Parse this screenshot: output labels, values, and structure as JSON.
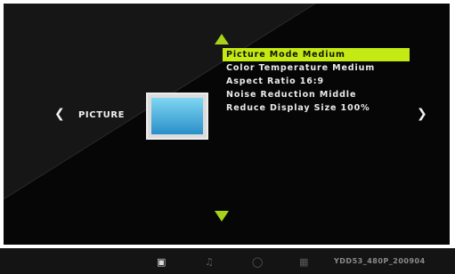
{
  "category": {
    "label": "PICTURE",
    "prev_glyph": "❮",
    "next_glyph": "❯"
  },
  "menu": {
    "items": [
      {
        "label": "Picture Mode Medium"
      },
      {
        "label": "Color Temperature Medium"
      },
      {
        "label": "Aspect Ratio 16:9"
      },
      {
        "label": "Noise Reduction Middle"
      },
      {
        "label": "Reduce Display Size 100%"
      }
    ],
    "selected_index": 0
  },
  "taskbar": {
    "icons": [
      {
        "name": "picture-mode-icon",
        "glyph": "▣",
        "active": true
      },
      {
        "name": "music-icon",
        "glyph": "♫",
        "active": false
      },
      {
        "name": "settings-circle-icon",
        "glyph": "◯",
        "active": false
      },
      {
        "name": "grid-icon",
        "glyph": "▦",
        "active": false
      }
    ],
    "version": "YDD53_480P_200904"
  },
  "colors": {
    "highlight": "#c3ea12",
    "arrow": "#a8d21a",
    "background": "#060606"
  }
}
